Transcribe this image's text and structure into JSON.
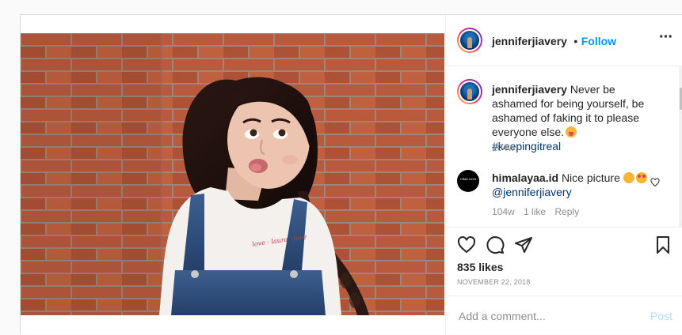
{
  "post": {
    "username": "jenniferjiavery",
    "follow_label": "Follow",
    "separator": "•",
    "more_icon": "more-horizontal-icon"
  },
  "caption": {
    "username": "jenniferjiavery",
    "text": "Never be ashamed for being yourself, be ashamed of faking it to please everyone else.",
    "emoji": "tongue-emoji",
    "hashtag": "#keepingitreal",
    "time": "104w"
  },
  "comment": {
    "username": "himalayaa.id",
    "text": "Nice picture",
    "emojis": [
      "smiling-face-emoji",
      "heart-eyes-emoji"
    ],
    "mention": "@jenniferjiavery",
    "time": "104w",
    "likes": "1 like",
    "reply": "Reply",
    "avatar_text": "HIMA LAYA"
  },
  "engagement": {
    "likes": "835 likes",
    "date": "NOVEMBER 22, 2018"
  },
  "composer": {
    "placeholder": "Add a comment...",
    "post_label": "Post"
  },
  "photo": {
    "shirt_text": "love · laura · love",
    "brick_color": "#b75a3e",
    "mortar_color": "#9c8a7e"
  },
  "colors": {
    "accent": "#0095f6",
    "link": "#00376b",
    "muted": "#8e8e8e",
    "post_disabled": "#b2dffc"
  }
}
